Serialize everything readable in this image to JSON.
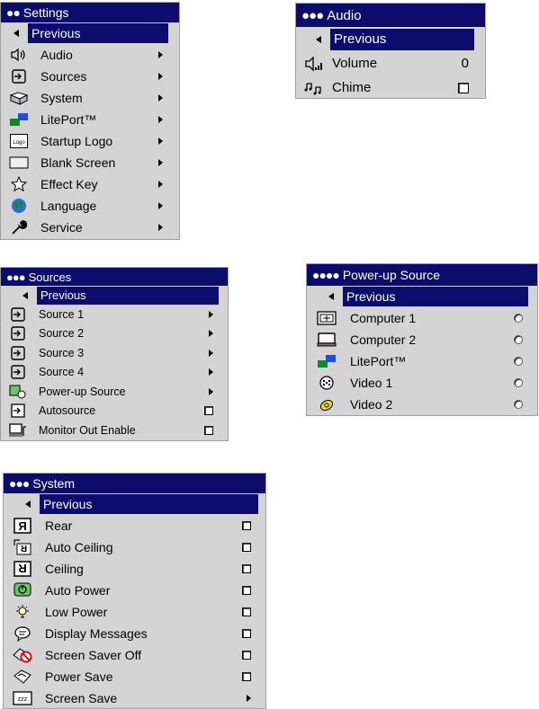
{
  "settings": {
    "dots": "●●",
    "title": "Settings",
    "previous": "Previous",
    "items": [
      {
        "label": "Audio",
        "icon": "speaker-icon"
      },
      {
        "label": "Sources",
        "icon": "source-icon"
      },
      {
        "label": "System",
        "icon": "system-icon"
      },
      {
        "label": "LitePort™",
        "icon": "liteport-icon"
      },
      {
        "label": "Startup Logo",
        "icon": "logo-icon",
        "icon_text": "Logo"
      },
      {
        "label": "Blank Screen",
        "icon": "blank-screen-icon"
      },
      {
        "label": "Effect Key",
        "icon": "star-icon"
      },
      {
        "label": "Language",
        "icon": "globe-icon"
      },
      {
        "label": "Service",
        "icon": "wrench-icon"
      }
    ]
  },
  "audio": {
    "dots": "●●●",
    "title": "Audio",
    "previous": "Previous",
    "volume_label": "Volume",
    "volume_value": "0",
    "chime_label": "Chime"
  },
  "sources": {
    "dots": "●●●",
    "title": "Sources",
    "previous": "Previous",
    "items": [
      {
        "label": "Source 1",
        "control": "arrow"
      },
      {
        "label": "Source 2",
        "control": "arrow"
      },
      {
        "label": "Source 3",
        "control": "arrow"
      },
      {
        "label": "Source 4",
        "control": "arrow"
      },
      {
        "label": "Power-up Source",
        "control": "arrow"
      },
      {
        "label": "Autosource",
        "control": "checkbox"
      },
      {
        "label": "Monitor Out Enable",
        "control": "checkbox"
      }
    ]
  },
  "powerup": {
    "dots": "●●●●",
    "title": "Power-up Source",
    "previous": "Previous",
    "items": [
      {
        "label": "Computer 1",
        "icon": "computer-icon"
      },
      {
        "label": "Computer 2",
        "icon": "monitor-icon"
      },
      {
        "label": "LitePort™",
        "icon": "liteport-icon"
      },
      {
        "label": "Video 1",
        "icon": "video-icon"
      },
      {
        "label": "Video 2",
        "icon": "video-2-icon"
      }
    ]
  },
  "system": {
    "dots": "●●●",
    "title": "System",
    "previous": "Previous",
    "items": [
      {
        "label": "Rear",
        "control": "checkbox",
        "icon": "rear-icon"
      },
      {
        "label": "Auto Ceiling",
        "control": "checkbox",
        "icon": "auto-ceiling-icon"
      },
      {
        "label": "Ceiling",
        "control": "checkbox",
        "icon": "ceiling-icon"
      },
      {
        "label": "Auto Power",
        "control": "checkbox",
        "icon": "auto-power-icon"
      },
      {
        "label": "Low Power",
        "control": "checkbox",
        "icon": "low-power-icon"
      },
      {
        "label": "Display Messages",
        "control": "checkbox",
        "icon": "speech-bubble-icon"
      },
      {
        "label": "Screen Saver Off",
        "control": "checkbox",
        "icon": "screen-saver-off-icon"
      },
      {
        "label": "Power Save",
        "control": "checkbox",
        "icon": "power-save-icon"
      },
      {
        "label": "Screen Save",
        "control": "arrow",
        "icon": "screen-save-icon"
      }
    ]
  },
  "colors": {
    "title_bar": "#0c0c6c",
    "menu_bg": "#d4d4d4",
    "highlight": "#0c0c6c"
  }
}
